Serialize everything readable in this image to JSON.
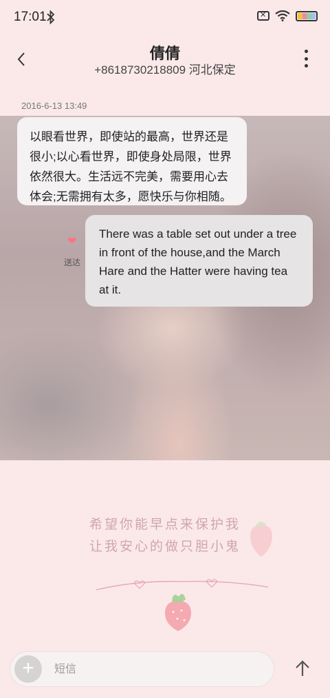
{
  "status_bar": {
    "time": "17:01",
    "icons": [
      "bluetooth-icon",
      "no-sim-icon",
      "wifi-icon",
      "battery-icon"
    ]
  },
  "header": {
    "contact_name": "倩倩",
    "contact_detail": "+8618730218809 河北保定"
  },
  "conversation": {
    "timestamp": "2016-6-13 13:49",
    "messages": [
      {
        "direction": "incoming",
        "text": "以眼看世界，即使站的最高，世界还是很小;以心看世界，即使身处局限，世界依然很大。生活远不完美，需要用心去体会;无需拥有太多，愿快乐与你相随。"
      },
      {
        "direction": "outgoing",
        "text": "There was a table set out under a tree in front of the house,and the March Hare and the Hatter were having tea at it.",
        "status": "送达"
      }
    ]
  },
  "wallpaper": {
    "line1": "希望你能早点来保护我",
    "line2": "让我安心的做只胆小鬼"
  },
  "composer": {
    "placeholder": "短信",
    "value": ""
  },
  "colors": {
    "background": "#fbe9ea",
    "bubble": "#f4f2f2",
    "accent_heart": "#ff7380"
  }
}
